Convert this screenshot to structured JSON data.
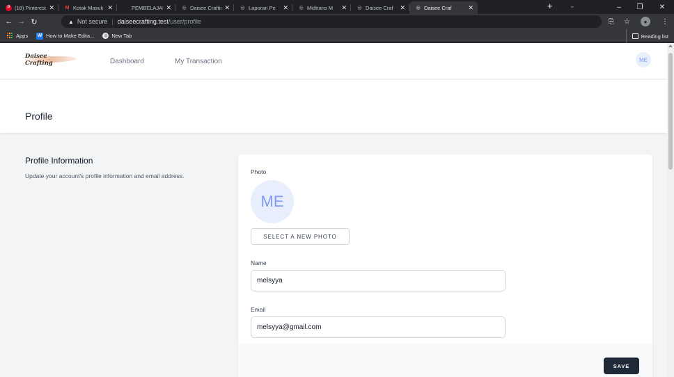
{
  "browser": {
    "tabs": [
      {
        "title": "(18) Pinterest",
        "icon": "pinterest-icon",
        "color": "#e60023",
        "glyph": "P"
      },
      {
        "title": "Kotak Masuk",
        "icon": "gmail-icon",
        "color": "#ea4335",
        "glyph": "M"
      },
      {
        "title": "PEMBELAJARAN",
        "icon": "blank-icon",
        "color": "#5f6368",
        "glyph": ""
      },
      {
        "title": "Daisee Crafting",
        "icon": "globe-icon",
        "color": "#bdc1c6",
        "glyph": "◎"
      },
      {
        "title": "Laporan Pe",
        "icon": "globe-icon",
        "color": "#bdc1c6",
        "glyph": "◎"
      },
      {
        "title": "Midtrans M",
        "icon": "globe-icon",
        "color": "#bdc1c6",
        "glyph": "◎"
      },
      {
        "title": "Daisee Craf",
        "icon": "globe-icon",
        "color": "#bdc1c6",
        "glyph": "◎"
      },
      {
        "title": "Daisee Craf",
        "icon": "globe-icon",
        "color": "#e8eaed",
        "glyph": "◎",
        "active": true
      }
    ],
    "address": {
      "security": "Not secure",
      "host": "daiseecrafting.test",
      "path": "/user/profile"
    },
    "bookmarks": {
      "apps": "Apps",
      "item1": "How to Make Edita...",
      "item2": "New Tab",
      "reading_list": "Reading list"
    }
  },
  "app": {
    "logo": "Daisee Crafting",
    "nav": {
      "dashboard": "Dashboard",
      "transactions": "My Transaction"
    },
    "user_initials": "ME"
  },
  "page": {
    "title": "Profile",
    "section": {
      "title": "Profile Information",
      "description": "Update your account's profile information and email address."
    },
    "form": {
      "photo_label": "Photo",
      "photo_initials": "ME",
      "select_photo": "SELECT A NEW PHOTO",
      "name_label": "Name",
      "name_value": "melsyya",
      "email_label": "Email",
      "email_value": "melsyya@gmail.com",
      "save": "SAVE"
    }
  }
}
